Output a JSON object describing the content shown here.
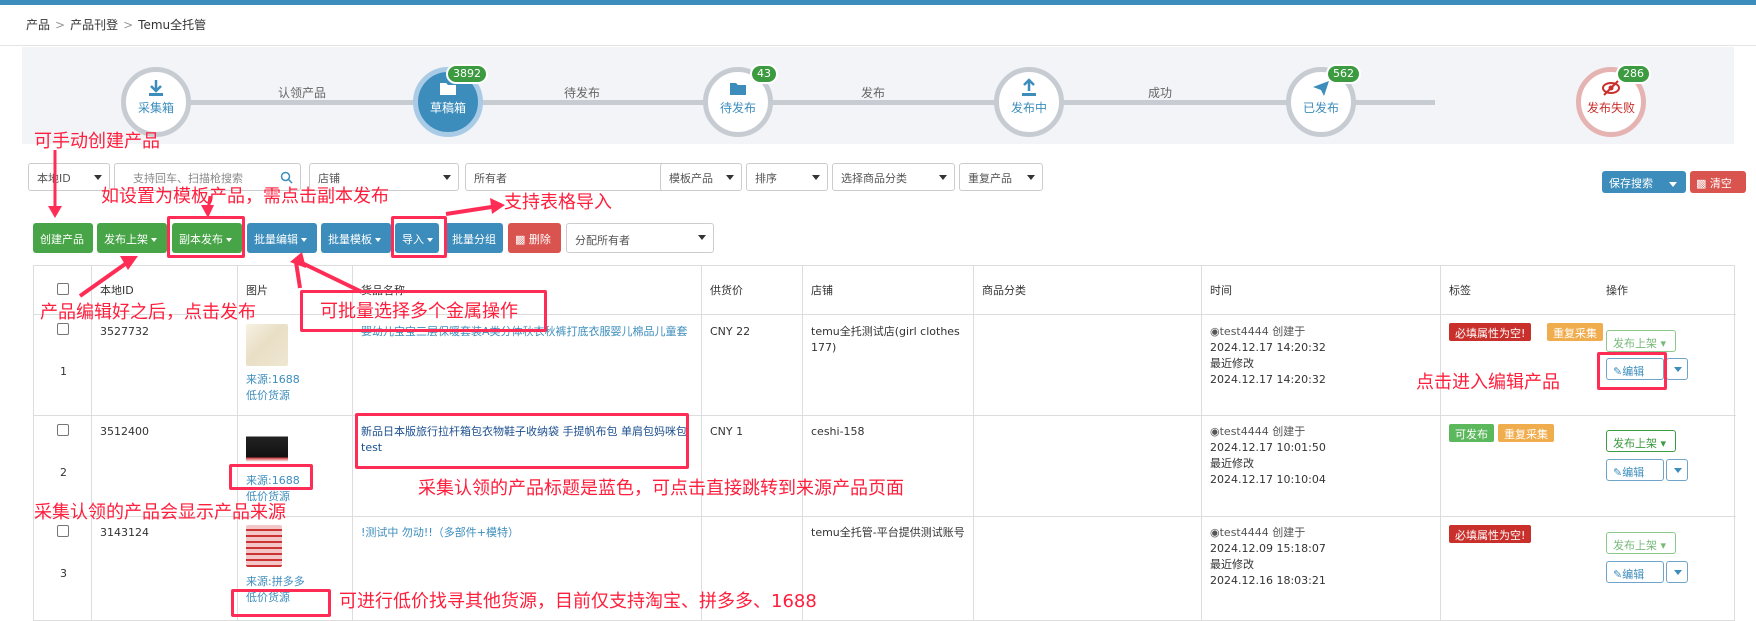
{
  "breadcrumb": [
    "产品",
    "产品刊登",
    "Temu全托管"
  ],
  "flow": {
    "steps": [
      {
        "label": "采集箱",
        "badge": "",
        "icon": "download-icon"
      },
      {
        "label": "草稿箱",
        "badge": "3892",
        "icon": "folder-icon"
      },
      {
        "label": "待发布",
        "badge": "43",
        "icon": "folder-icon"
      },
      {
        "label": "发布中",
        "badge": "",
        "icon": "upload-icon"
      },
      {
        "label": "已发布",
        "badge": "562",
        "icon": "send-icon"
      },
      {
        "label": "发布失败",
        "badge": "286",
        "icon": "eye-slash-icon"
      }
    ],
    "edges": [
      "认领产品",
      "待发布",
      "发布",
      "成功"
    ]
  },
  "filters": {
    "local_id": "本地ID",
    "search_placeholder": "支持回车、扫描枪搜索",
    "store": "店铺",
    "owner": "所有者",
    "template": "模板产品",
    "sort": "排序",
    "category": "选择商品分类",
    "duplicate": "重复产品",
    "save_search": "保存搜索",
    "clear": "清空"
  },
  "toolbar": {
    "create": "创建产品",
    "publish": "发布上架",
    "copy_publish": "副本发布",
    "batch_edit": "批量编辑",
    "batch_template": "批量模板",
    "import": "导入",
    "batch_group": "批量分组",
    "delete": "删除",
    "assign_owner": "分配所有者"
  },
  "table": {
    "headers": [
      "本地ID",
      "图片",
      "货品名称",
      "供货价",
      "店铺",
      "商品分类",
      "时间",
      "标签",
      "操作"
    ],
    "rows": [
      {
        "index": "1",
        "local_id": "3527732",
        "source": "来源:1688",
        "low_price": "低价货源",
        "name": "婴幼儿宝宝三层保暖套装A类分体秋衣秋裤打底衣服婴儿棉品儿童套",
        "price": "CNY 22",
        "store": "temu全托测试店(girl clothes 177)",
        "user": "test4444",
        "created_label": "创建于",
        "created": "2024.12.17 14:20:32",
        "modified_label": "最近修改",
        "modified": "2024.12.17 14:20:32",
        "tags": [
          "必填属性为空!",
          "重复采集"
        ],
        "publish": "发布上架",
        "edit": "编辑"
      },
      {
        "index": "2",
        "local_id": "3512400",
        "source": "来源:1688",
        "low_price": "低价货源",
        "name": "新品日本版旅行拉杆箱包衣物鞋子收纳袋 手提帆布包 单肩包妈咪包 test",
        "price": "CNY 1",
        "store": "ceshi-158",
        "user": "test4444",
        "created_label": "创建于",
        "created": "2024.12.17 10:01:50",
        "modified_label": "最近修改",
        "modified": "2024.12.17 10:10:04",
        "tags": [
          "可发布",
          "重复采集"
        ],
        "publish": "发布上架",
        "edit": "编辑"
      },
      {
        "index": "3",
        "local_id": "3143124",
        "source": "来源:拼多多",
        "low_price": "低价货源",
        "name": "!测试中 勿动!!（多部件+模特）",
        "price": "",
        "store": "temu全托管-平台提供测试账号",
        "user": "test4444",
        "created_label": "创建于",
        "created": "2024.12.09 15:18:07",
        "modified_label": "最近修改",
        "modified": "2024.12.16 18:03:21",
        "tags": [
          "必填属性为空!"
        ],
        "publish": "发布上架",
        "edit": "编辑"
      }
    ]
  },
  "annotations": {
    "manual_create": "可手动创建产品",
    "template_copy": "如设置为模板产品，需点击副本发布",
    "table_import": "支持表格导入",
    "after_edit_publish": "产品编辑好之后，点击发布",
    "batch_select": "可批量选择多个金属操作",
    "click_edit": "点击进入编辑产品",
    "blue_title": "采集认领的产品标题是蓝色，可点击直接跳转到来源产品页面",
    "show_source": "采集认领的产品会显示产品来源",
    "low_price_source": "可进行低价找寻其他货源，目前仅支持淘宝、拼多多、1688"
  },
  "colors": {
    "primary": "#3c8dbc",
    "success": "#47a447",
    "danger": "#d9534f",
    "warning": "#f0ad4e",
    "annotation": "#ff1e3c"
  }
}
